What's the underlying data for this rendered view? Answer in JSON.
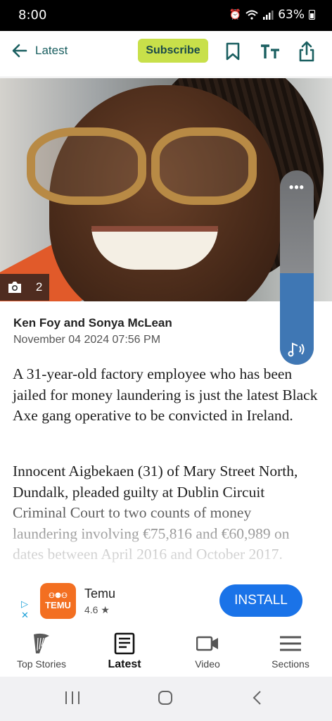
{
  "status_bar": {
    "time": "8:00",
    "alarm_icon": "alarm-icon",
    "wifi_icon": "wifi-icon",
    "signal_icon": "signal-icon",
    "battery": "63%"
  },
  "toolbar": {
    "back_label": "Latest",
    "subscribe_label": "Subscribe",
    "icons": [
      "bookmark-icon",
      "text-size-icon",
      "share-icon"
    ],
    "accent_color": "#1a5f60",
    "subscribe_color": "#c8e04a"
  },
  "hero": {
    "photo_count": "2",
    "camera_icon": "camera-icon"
  },
  "audio_player": {
    "menu_icon": "more-dots-icon",
    "audio_icon": "listen-audio-icon",
    "level": 0.47
  },
  "article": {
    "authors": "Ken Foy and Sonya McLean",
    "date": "November 04 2024 07:56 PM",
    "paragraphs": [
      "A 31-year-old factory employee who has been jailed for money laundering is just the latest Black Axe gang operative to be convicted in Ireland.",
      "Innocent Aigbekaen (31) of Mary Street North, Dundalk, pleaded guilty at Dublin Circuit Criminal Court to two counts of money laundering involving €75,816 and €60,989 on dates between April 2016 and October 2017."
    ]
  },
  "ad": {
    "app_name": "Temu",
    "app_logo_text": "TEMU",
    "rating": "4.6 ★",
    "install_label": "INSTALL",
    "install_color": "#1a73e8"
  },
  "bottom_nav": {
    "items": [
      {
        "label": "Top Stories",
        "icon": "harp-icon"
      },
      {
        "label": "Latest",
        "icon": "latest-list-icon"
      },
      {
        "label": "Video",
        "icon": "video-camera-icon"
      },
      {
        "label": "Sections",
        "icon": "hamburger-menu-icon"
      }
    ],
    "active_index": 1
  },
  "system_nav": {
    "icons": [
      "recent-apps-icon",
      "home-icon",
      "back-icon"
    ]
  }
}
